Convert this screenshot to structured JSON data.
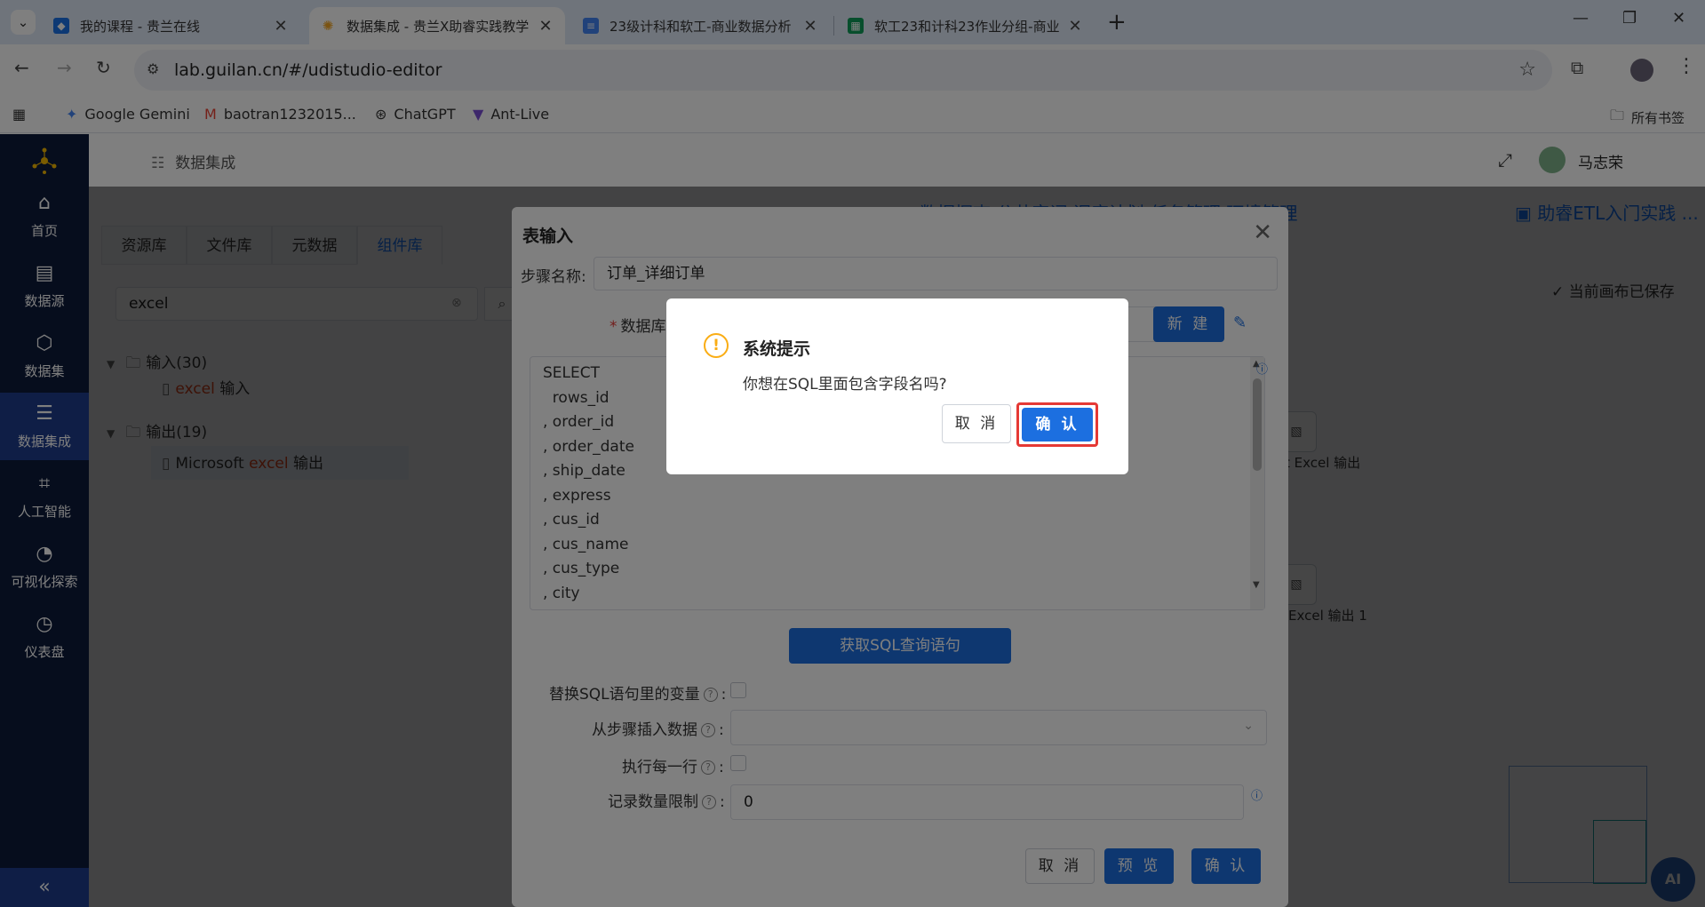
{
  "browser": {
    "tabs": [
      {
        "title": "我的课程 - 贵兰在线",
        "icon": "book-icon",
        "icon_color": "#1a73e8",
        "active": false
      },
      {
        "title": "数据集成 - 贵兰X助睿实践教学",
        "icon": "app-logo-icon",
        "icon_color": "#f5a623",
        "active": true
      },
      {
        "title": "23级计科和软工-商业数据分析",
        "icon": "doc-icon",
        "icon_color": "#4285f4",
        "active": false
      },
      {
        "title": "软工23和计科23作业分组-商业",
        "icon": "sheet-icon",
        "icon_color": "#0f9d58",
        "active": false
      }
    ],
    "url": "lab.guilan.cn/#/udistudio-editor",
    "bookmarks": [
      {
        "label": "Google Gemini",
        "icon": "gemini-icon"
      },
      {
        "label": "baotran1232015...",
        "icon": "gmail-icon"
      },
      {
        "label": "ChatGPT",
        "icon": "chatgpt-icon"
      },
      {
        "label": "Ant-Live",
        "icon": "ant-icon"
      }
    ],
    "all_bookmarks": "所有书签"
  },
  "sidebar": {
    "items": [
      {
        "label": "首页",
        "icon": "home-icon",
        "active": false
      },
      {
        "label": "数据源",
        "icon": "datasource-icon",
        "active": false
      },
      {
        "label": "数据集",
        "icon": "cube-icon",
        "active": false
      },
      {
        "label": "数据集成",
        "icon": "integration-icon",
        "active": true
      },
      {
        "label": "人工智能",
        "icon": "ai-icon",
        "active": false
      },
      {
        "label": "可视化探索",
        "icon": "pie-chart-icon",
        "active": false
      },
      {
        "label": "仪表盘",
        "icon": "gauge-icon",
        "active": false
      }
    ]
  },
  "header": {
    "breadcrumb": "数据集成",
    "user": "马志荣"
  },
  "workspace": {
    "left_tabs": [
      "资源库",
      "文件库",
      "元数据",
      "组件库"
    ],
    "active_left_tab": 3,
    "search_value": "excel",
    "tree": {
      "input_group": "输入(30)",
      "input_item_prefix": "excel",
      "input_item_suffix": " 输入",
      "output_group": "输出(19)",
      "output_item_prefix": "Microsoft ",
      "output_item_hl": "excel",
      "output_item_suffix": " 输出"
    },
    "top_links": "数据探查 公共字词 调度计划 任务管理 环境管理",
    "project": "助睿ETL入门实践 ...",
    "saved_status": "当前画布已保存",
    "canvas_labels": [
      "t Excel 输出",
      "Excel 输出 1"
    ],
    "ai_button": "AI"
  },
  "dialog": {
    "title": "表输入",
    "step_name_label": "步骤名称:",
    "step_name_value": "订单_详细订单",
    "database_label": "数据库",
    "new_button": "新 建",
    "sql_lines": [
      "SELECT",
      "  rows_id",
      ", order_id",
      ", order_date",
      ", ship_date",
      ", express",
      ", cus_id",
      ", cus_name",
      ", cus_type",
      ", city"
    ],
    "get_sql_button": "获取SQL查询语句",
    "replace_vars_label": "替换SQL语句里的变量",
    "insert_from_step_label": "从步骤插入数据",
    "execute_each_row_label": "执行每一行",
    "record_limit_label": "记录数量限制",
    "record_limit_value": "0",
    "cancel_button": "取 消",
    "preview_button": "预 览",
    "confirm_button": "确 认"
  },
  "prompt": {
    "title": "系统提示",
    "message": "你想在SQL里面包含字段名吗?",
    "cancel": "取 消",
    "confirm": "确 认"
  }
}
